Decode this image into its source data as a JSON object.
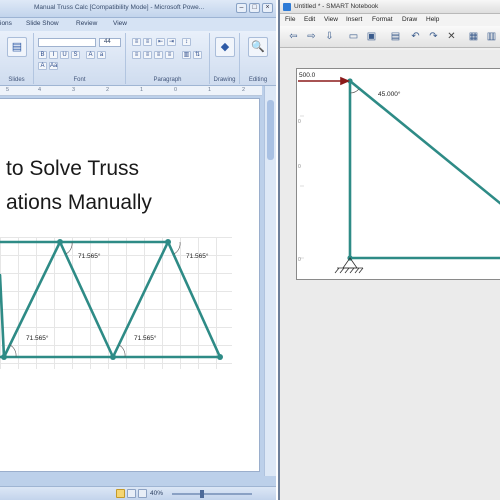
{
  "powerpoint": {
    "window_title": "Manual Truss Calc [Compatibility Mode] - Microsoft Powe...",
    "tabs": [
      "ions",
      "Slide Show",
      "Review",
      "View"
    ],
    "groups": {
      "slides": "Slides",
      "font": "Font",
      "paragraph": "Paragraph",
      "drawing": "Drawing",
      "editing": "Editing"
    },
    "font_size": "44",
    "ruler": [
      "5",
      "4",
      "3",
      "2",
      "1",
      "0",
      "1",
      "2"
    ],
    "slide": {
      "title_line1": "to Solve Truss",
      "title_line2": "ations Manually",
      "angle_labels": [
        "71.565°",
        "71.565°",
        "71.565°",
        "71.565°"
      ]
    },
    "status": {
      "zoom": "40%"
    }
  },
  "notebook": {
    "window_title": "Untitled * - SMART Notebook",
    "menu": [
      "File",
      "Edit",
      "View",
      "Insert",
      "Format",
      "Draw",
      "Help"
    ],
    "toolbar_icons": [
      "previous-page-icon",
      "next-page-icon",
      "import-icon",
      "open-icon",
      "save-icon",
      "paste-icon",
      "undo-icon",
      "redo-icon",
      "delete-icon",
      "screen-shade-icon",
      "table-icon"
    ],
    "force_label": "500.0",
    "angle_label": "45.000°",
    "axis_ticks": [
      "0",
      "0",
      "0"
    ]
  },
  "colors": {
    "truss": "#2e8b86",
    "force_arrow": "#8b1a1a",
    "ribbon": "#cfdcef"
  }
}
